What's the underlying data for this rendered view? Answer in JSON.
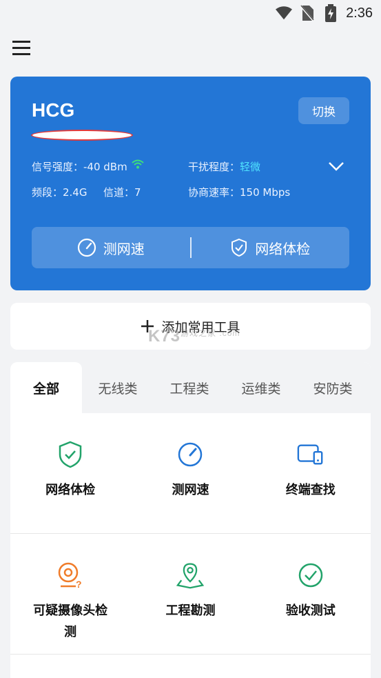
{
  "status_bar": {
    "time": "2:36"
  },
  "wifi_card": {
    "ssid": "HCG",
    "switch_label": "切换",
    "signal_label": "信号强度：-40 dBm",
    "interference_label": "干扰程度：",
    "interference_value": "轻微",
    "band_label": "频段：2.4G",
    "channel_label": "信道：7",
    "rate_label": "协商速率：150 Mbps",
    "speed_test_label": "测网速",
    "network_check_label": "网络体检"
  },
  "add_tools": {
    "label": "添加常用工具"
  },
  "watermark": {
    "text": "K73",
    "sub": "游戏之家 .com"
  },
  "tabs": [
    {
      "label": "全部"
    },
    {
      "label": "无线类"
    },
    {
      "label": "工程类"
    },
    {
      "label": "运维类"
    },
    {
      "label": "安防类"
    }
  ],
  "tools": [
    {
      "label": "网络体检",
      "icon": "shield-check-icon",
      "color": "#22a36a"
    },
    {
      "label": "测网速",
      "icon": "speedometer-icon",
      "color": "#2376d6"
    },
    {
      "label": "终端查找",
      "icon": "devices-icon",
      "color": "#2376d6"
    },
    {
      "label": "可疑摄像头检测",
      "icon": "camera-question-icon",
      "color": "#f07c2a"
    },
    {
      "label": "工程勘测",
      "icon": "map-pin-icon",
      "color": "#22a36a"
    },
    {
      "label": "验收测试",
      "icon": "check-circle-icon",
      "color": "#22a36a"
    }
  ]
}
